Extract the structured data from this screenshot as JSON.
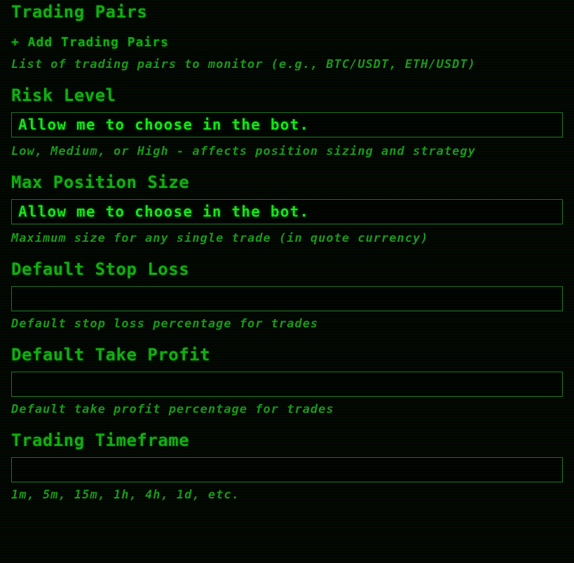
{
  "theme": {
    "background": "#020502",
    "heading_color": "#12b212",
    "help_color": "#1a9c1a",
    "input_text_color": "#18e81c",
    "input_border_color": "#1e7a1e"
  },
  "sections": [
    {
      "id": "trading-pairs",
      "title": "Trading Pairs",
      "control": "add-link",
      "add_label": "+ Add Trading Pairs",
      "help": "List of trading pairs to monitor (e.g., BTC/USDT, ETH/USDT)"
    },
    {
      "id": "risk-level",
      "title": "Risk Level",
      "control": "input",
      "value": "Allow me to choose in the bot.",
      "help": "Low, Medium, or High - affects position sizing and strategy"
    },
    {
      "id": "max-position-size",
      "title": "Max Position Size",
      "control": "input",
      "value": "Allow me to choose in the bot.",
      "help": "Maximum size for any single trade (in quote currency)"
    },
    {
      "id": "default-stop-loss",
      "title": "Default Stop Loss",
      "control": "input",
      "value": "",
      "help": "Default stop loss percentage for trades"
    },
    {
      "id": "default-take-profit",
      "title": "Default Take Profit",
      "control": "input",
      "value": "",
      "help": "Default take profit percentage for trades"
    },
    {
      "id": "trading-timeframe",
      "title": "Trading Timeframe",
      "control": "input",
      "value": "",
      "help": "1m, 5m, 15m, 1h, 4h, 1d, etc."
    }
  ]
}
